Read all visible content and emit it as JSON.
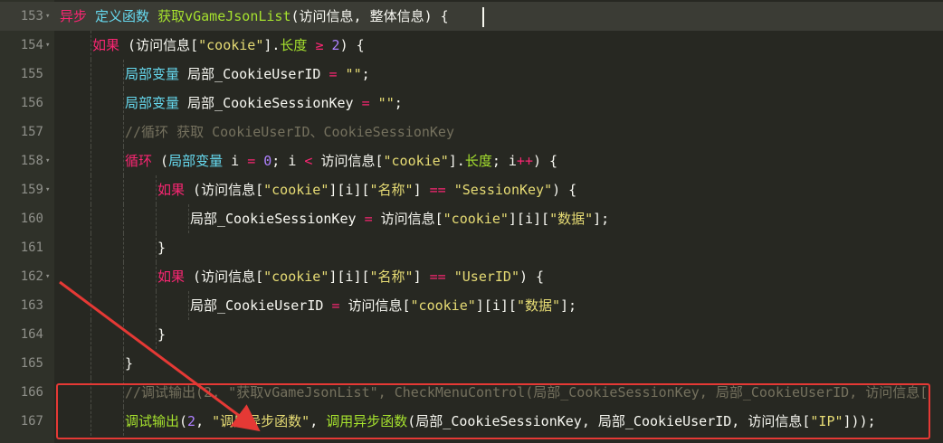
{
  "editor": {
    "lines": [
      {
        "number": "153",
        "fold": true,
        "active": true,
        "indent": 0,
        "tokens": [
          {
            "t": "异步",
            "c": "kw"
          },
          {
            "t": " "
          },
          {
            "t": "定义函数",
            "c": "kw2"
          },
          {
            "t": " "
          },
          {
            "t": "获取vGameJsonList",
            "c": "fn"
          },
          {
            "t": "(访问信息, 整体信息) {"
          }
        ]
      },
      {
        "number": "154",
        "fold": true,
        "indent": 1,
        "tokens": [
          {
            "t": "如果",
            "c": "kw"
          },
          {
            "t": " (访问信息["
          },
          {
            "t": "\"cookie\"",
            "c": "str"
          },
          {
            "t": "]."
          },
          {
            "t": "长度",
            "c": "prop"
          },
          {
            "t": " "
          },
          {
            "t": "≥",
            "c": "op"
          },
          {
            "t": " "
          },
          {
            "t": "2",
            "c": "num"
          },
          {
            "t": ") {"
          }
        ]
      },
      {
        "number": "155",
        "indent": 2,
        "tokens": [
          {
            "t": "局部变量",
            "c": "kw2"
          },
          {
            "t": " 局部_CookieUserID "
          },
          {
            "t": "=",
            "c": "op"
          },
          {
            "t": " "
          },
          {
            "t": "\"\"",
            "c": "str"
          },
          {
            "t": ";"
          }
        ]
      },
      {
        "number": "156",
        "indent": 2,
        "tokens": [
          {
            "t": "局部变量",
            "c": "kw2"
          },
          {
            "t": " 局部_CookieSessionKey "
          },
          {
            "t": "=",
            "c": "op"
          },
          {
            "t": " "
          },
          {
            "t": "\"\"",
            "c": "str"
          },
          {
            "t": ";"
          }
        ]
      },
      {
        "number": "157",
        "indent": 2,
        "tokens": [
          {
            "t": "//循环 获取 CookieUserID、CookieSessionKey",
            "c": "cm"
          }
        ]
      },
      {
        "number": "158",
        "fold": true,
        "indent": 2,
        "tokens": [
          {
            "t": "循环",
            "c": "kw"
          },
          {
            "t": " ("
          },
          {
            "t": "局部变量",
            "c": "kw2"
          },
          {
            "t": " i "
          },
          {
            "t": "=",
            "c": "op"
          },
          {
            "t": " "
          },
          {
            "t": "0",
            "c": "num"
          },
          {
            "t": "; i "
          },
          {
            "t": "<",
            "c": "op"
          },
          {
            "t": " 访问信息["
          },
          {
            "t": "\"cookie\"",
            "c": "str"
          },
          {
            "t": "]."
          },
          {
            "t": "长度",
            "c": "prop"
          },
          {
            "t": "; i"
          },
          {
            "t": "++",
            "c": "op"
          },
          {
            "t": ") {"
          }
        ]
      },
      {
        "number": "159",
        "fold": true,
        "indent": 3,
        "tokens": [
          {
            "t": "如果",
            "c": "kw"
          },
          {
            "t": " (访问信息["
          },
          {
            "t": "\"cookie\"",
            "c": "str"
          },
          {
            "t": "][i]["
          },
          {
            "t": "\"名称\"",
            "c": "str"
          },
          {
            "t": "] "
          },
          {
            "t": "==",
            "c": "op"
          },
          {
            "t": " "
          },
          {
            "t": "\"SessionKey\"",
            "c": "str"
          },
          {
            "t": ") {"
          }
        ]
      },
      {
        "number": "160",
        "indent": 4,
        "tokens": [
          {
            "t": "局部_CookieSessionKey "
          },
          {
            "t": "=",
            "c": "op"
          },
          {
            "t": " 访问信息["
          },
          {
            "t": "\"cookie\"",
            "c": "str"
          },
          {
            "t": "][i]["
          },
          {
            "t": "\"数据\"",
            "c": "str"
          },
          {
            "t": "];"
          }
        ]
      },
      {
        "number": "161",
        "indent": 3,
        "tokens": [
          {
            "t": "}"
          }
        ]
      },
      {
        "number": "162",
        "fold": true,
        "indent": 3,
        "tokens": [
          {
            "t": "如果",
            "c": "kw"
          },
          {
            "t": " (访问信息["
          },
          {
            "t": "\"cookie\"",
            "c": "str"
          },
          {
            "t": "][i]["
          },
          {
            "t": "\"名称\"",
            "c": "str"
          },
          {
            "t": "] "
          },
          {
            "t": "==",
            "c": "op"
          },
          {
            "t": " "
          },
          {
            "t": "\"UserID\"",
            "c": "str"
          },
          {
            "t": ") {"
          }
        ]
      },
      {
        "number": "163",
        "indent": 4,
        "tokens": [
          {
            "t": "局部_CookieUserID "
          },
          {
            "t": "=",
            "c": "op"
          },
          {
            "t": " 访问信息["
          },
          {
            "t": "\"cookie\"",
            "c": "str"
          },
          {
            "t": "][i]["
          },
          {
            "t": "\"数据\"",
            "c": "str"
          },
          {
            "t": "];"
          }
        ]
      },
      {
        "number": "164",
        "indent": 3,
        "tokens": [
          {
            "t": "}"
          }
        ]
      },
      {
        "number": "165",
        "indent": 2,
        "tokens": [
          {
            "t": "}"
          }
        ]
      },
      {
        "number": "166",
        "indent": 2,
        "tokens": [
          {
            "t": "//调试输出(2, \"获取vGameJsonList\", CheckMenuControl(局部_CookieSessionKey, 局部_CookieUserID, 访问信息[",
            "c": "cm"
          }
        ]
      },
      {
        "number": "167",
        "indent": 2,
        "tokens": [
          {
            "t": "调试输出",
            "c": "fn"
          },
          {
            "t": "("
          },
          {
            "t": "2",
            "c": "num"
          },
          {
            "t": ", "
          },
          {
            "t": "\"调用异步函数\"",
            "c": "str"
          },
          {
            "t": ", "
          },
          {
            "t": "调用异步函数",
            "c": "fn"
          },
          {
            "t": "(局部_CookieSessionKey, 局部_CookieUserID, 访问信息["
          },
          {
            "t": "\"IP\"",
            "c": "str"
          },
          {
            "t": "]));"
          }
        ]
      }
    ]
  },
  "colors": {
    "background": "#272822",
    "annotation": "#e53935"
  }
}
